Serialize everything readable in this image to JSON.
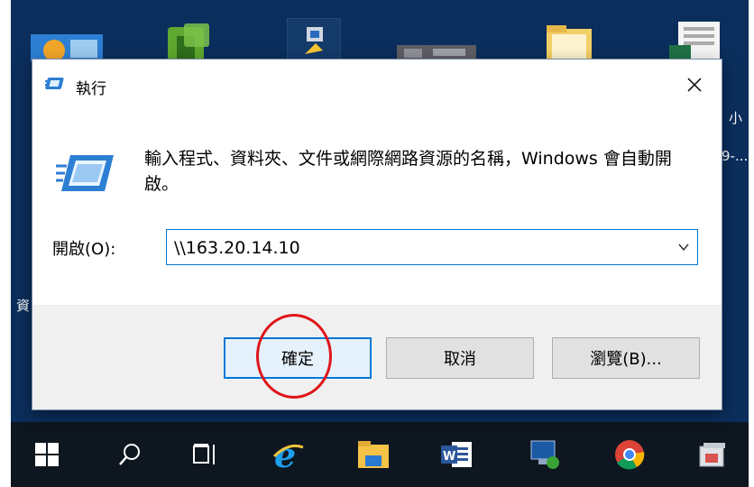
{
  "desktop": {
    "edge_texts": [
      "小",
      "9-...",
      "資"
    ]
  },
  "dialog": {
    "title": "執行",
    "description": "輸入程式、資料夾、文件或網際網路資源的名稱，Windows 會自動開啟。",
    "open_label": "開啟(O):",
    "open_value": "\\\\163.20.14.10",
    "buttons": {
      "ok": "確定",
      "cancel": "取消",
      "browse": "瀏覽(B)..."
    }
  },
  "taskbar": {
    "icons": [
      "windows-start-icon",
      "search-icon",
      "task-view-icon",
      "internet-explorer-icon",
      "file-explorer-icon",
      "word-icon",
      "remote-desktop-icon",
      "chrome-icon",
      "app-icon"
    ]
  },
  "colors": {
    "accent": "#0078d7",
    "highlight_circle": "#e0151a",
    "desktop_background": "#0b2e5c",
    "taskbar": "#0e1620"
  }
}
